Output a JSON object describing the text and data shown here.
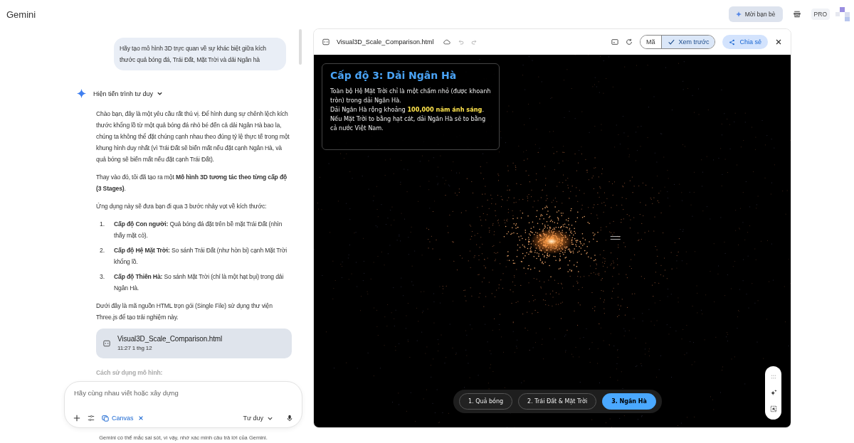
{
  "app": {
    "title": "Gemini"
  },
  "header": {
    "invite_button": "Mời bạn bè",
    "plan_badge": "PRO"
  },
  "chat": {
    "user_message": "Hãy tạo mô hình 3D trực quan về sự khác biệt giữa kích thước quả bóng đá, Trái Đất, Mặt Trời và dải Ngân hà",
    "thinking_toggle": "Hiện tiến trình tư duy",
    "paragraphs": [
      "Chào bạn, đây là một yêu cầu rất thú vị. Để hình dung sự chênh lệch kích thước khổng lồ từ một quả bóng đá nhỏ bé đến cả dải Ngân Hà bao la, chúng ta không thể đặt chúng cạnh nhau theo đúng tỷ lệ thực tế trong một khung hình duy nhất (vì Trái Đất sẽ biến mất nếu đặt cạnh Ngân Hà, và quả bóng sẽ biến mất nếu đặt cạnh Trái Đất).",
      "Thay vào đó, tôi đã tạo ra một **Mô hình 3D tương tác theo từng cấp độ (3 Stages)**.",
      "Ứng dụng này sẽ đưa bạn đi qua 3 bước nhảy vọt về kích thước:"
    ],
    "steps": [
      {
        "number": "1.",
        "text": "**Cấp độ Con người:** Quả bóng đá đặt trên bề mặt Trái Đất (nhìn thấy mặt cỏ)."
      },
      {
        "number": "2.",
        "text": "**Cấp độ Hệ Mặt Trời:** So sánh Trái Đất (như hòn bi) cạnh Mặt Trời khổng lồ."
      },
      {
        "number": "3.",
        "text": "**Cấp độ Thiên Hà:** So sánh Mặt Trời (chỉ là một hạt bụi) trong dải Ngân Hà."
      }
    ],
    "closing": "Dưới đây là mã nguồn HTML trọn gói (Single File) sử dụng thư viện Three.js để tạo trải nghiệm này.",
    "file_card": {
      "name": "Visual3D_Scale_Comparison.html",
      "time": "11:27 1 thg 12"
    },
    "faded_heading": "Cách sử dụng mô hình:"
  },
  "composer": {
    "placeholder": "Hãy cùng nhau viết hoặc xây dựng",
    "tool_chip": "Canvas",
    "mode": "Tư duy"
  },
  "disclaimer": "Gemini có thể mắc sai sót, vì vậy, nhớ xác minh câu trả lời của Gemini.",
  "canvas": {
    "file_name": "Visual3D_Scale_Comparison.html",
    "view_tabs": [
      {
        "label": "Mã",
        "selected": false
      },
      {
        "label": "Xem trước",
        "selected": true
      }
    ],
    "share_button": "Chia sẻ",
    "info_box": {
      "title": "Cấp độ 3: Dải Ngân Hà",
      "lines": [
        "Toàn bộ Hệ Mặt Trời chỉ là một chấm nhỏ (được khoanh tròn) trong dải Ngân Hà.",
        "Dải Ngân Hà rộng khoảng **100,000 năm ánh sáng**.",
        "Nếu Mặt Trời to bằng hạt cát, dải Ngân Hà sẽ to bằng cả nước Việt Nam."
      ]
    },
    "stages": [
      {
        "label": "1. Quả bóng",
        "selected": false
      },
      {
        "label": "2. Trái Đất & Mặt Trời",
        "selected": false
      },
      {
        "label": "3. Ngân Hà",
        "selected": true
      }
    ]
  }
}
